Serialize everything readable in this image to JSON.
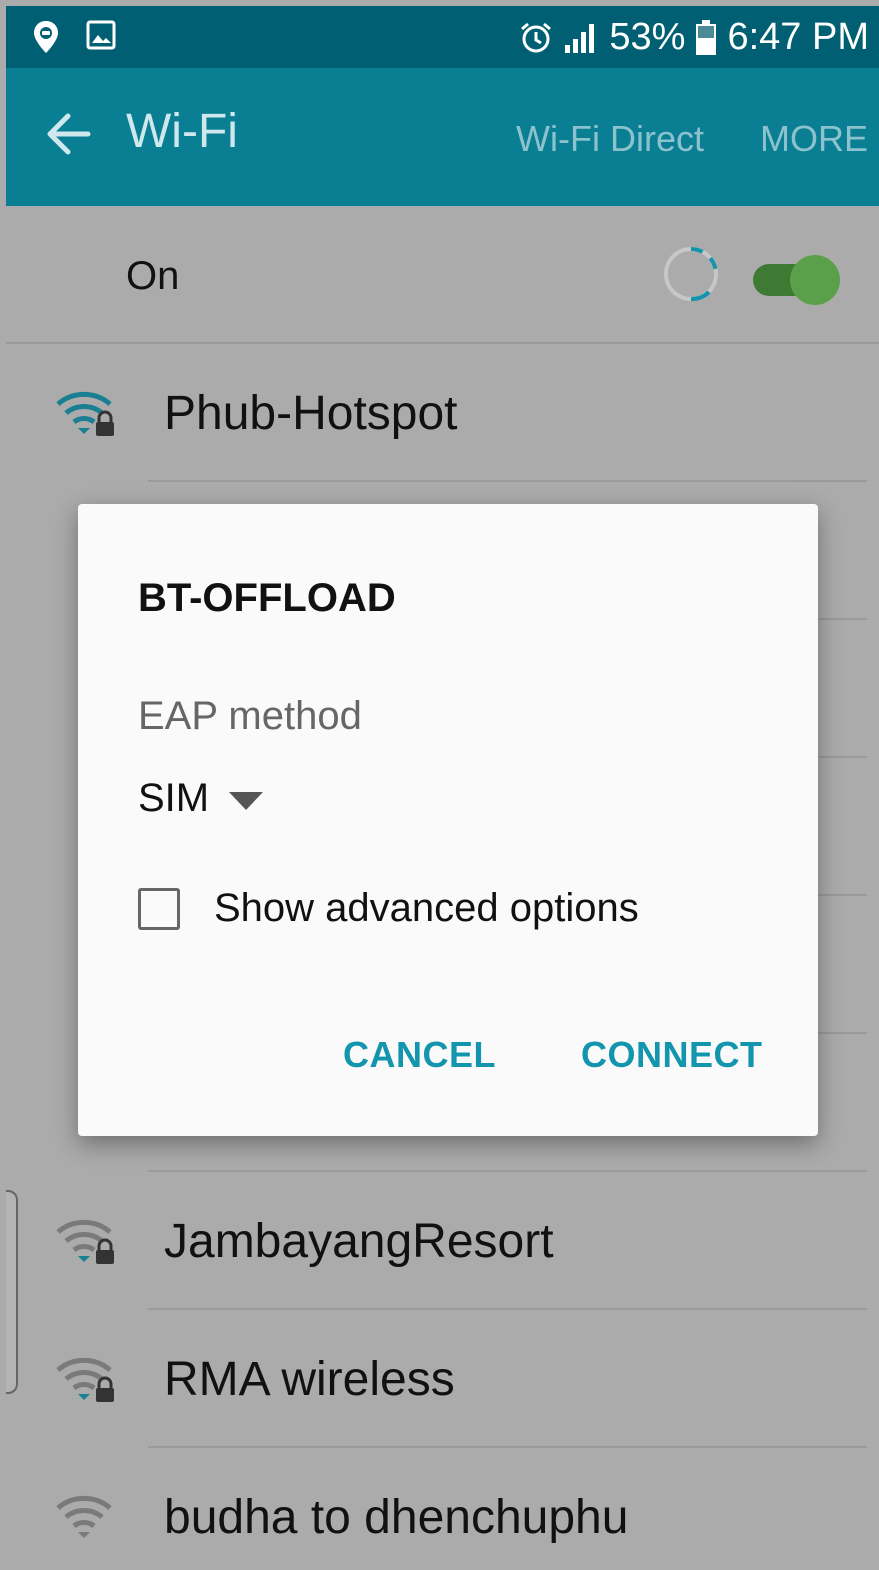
{
  "status_bar": {
    "icons_left": [
      "location-pin-icon",
      "image-icon"
    ],
    "icons_right": [
      "alarm-icon",
      "signal-icon",
      "battery-icon"
    ],
    "battery": "53%",
    "time": "6:47 PM"
  },
  "app_bar": {
    "title": "Wi-Fi",
    "wifi_direct_label": "Wi-Fi Direct",
    "more_label": "MORE"
  },
  "wifi_toggle": {
    "label": "On",
    "enabled": true
  },
  "networks": [
    {
      "name": "Phub-Hotspot",
      "secured": true,
      "accent": true
    },
    {
      "name": "JambayangResort",
      "secured": true,
      "accent": true
    },
    {
      "name": "RMA wireless",
      "secured": true,
      "accent": true
    },
    {
      "name": "budha to dhenchuphu",
      "secured": false,
      "accent": false
    }
  ],
  "dialog": {
    "title": "BT-OFFLOAD",
    "eap_label": "EAP method",
    "eap_value": "SIM",
    "advanced_label": "Show advanced options",
    "advanced_checked": false,
    "cancel_label": "CANCEL",
    "connect_label": "CONNECT"
  },
  "colors": {
    "status_bar": "#005f72",
    "app_bar": "#0a7e92",
    "accent": "#1295ad",
    "toggle_on": "#5aa04a"
  }
}
